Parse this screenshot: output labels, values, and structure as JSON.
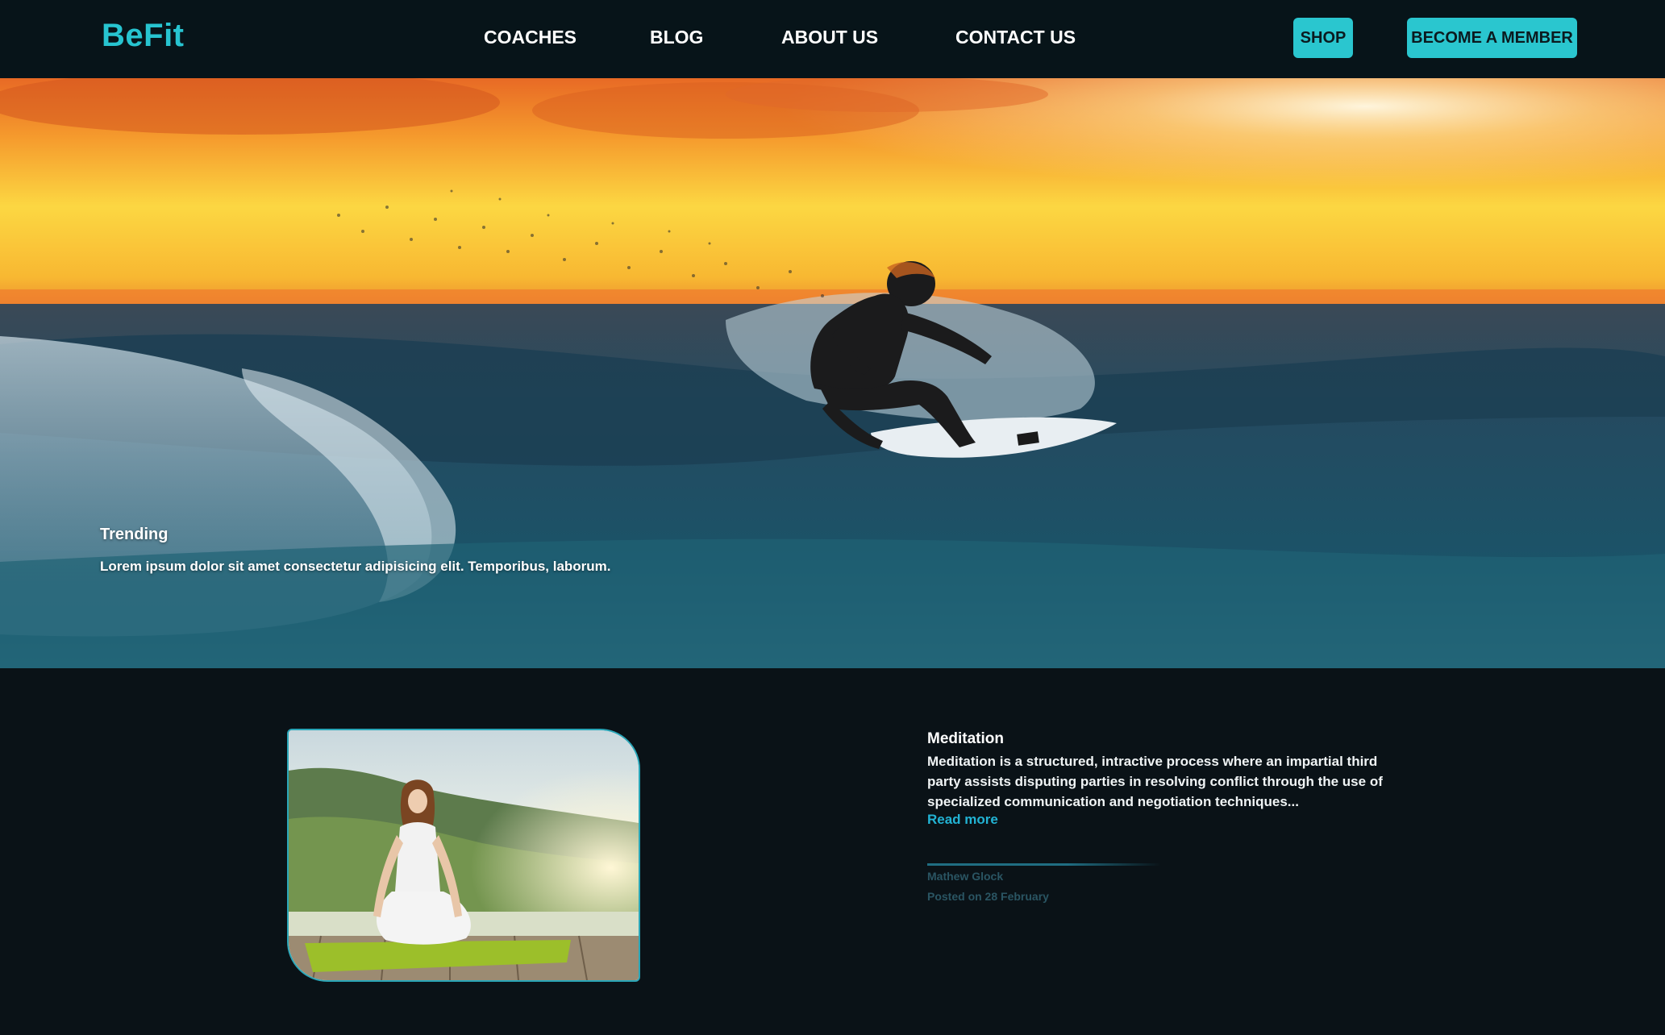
{
  "brand": {
    "name": "BeFit",
    "accent_color": "#27c4d0"
  },
  "nav": {
    "links": [
      "COACHES",
      "BLOG",
      "ABOUT US",
      "CONTACT US"
    ],
    "shop_label": "SHOP",
    "member_label": "BECOME A MEMBER"
  },
  "hero": {
    "trending_label": "Trending",
    "text": "Lorem ipsum dolor sit amet consectetur adipisicing elit. Temporibus, laborum.",
    "image": "surfer-on-wave-at-sunset"
  },
  "article": {
    "image": "woman-meditating-on-dock",
    "title": "Meditation",
    "body": "Meditation is a structured, intractive process where an impartial third party assists disputing parties in resolving conflict through the use of specialized communication and negotiation techniques...",
    "read_more": "Read more",
    "author": "Mathew Glock",
    "posted": "Posted on 28 February"
  }
}
